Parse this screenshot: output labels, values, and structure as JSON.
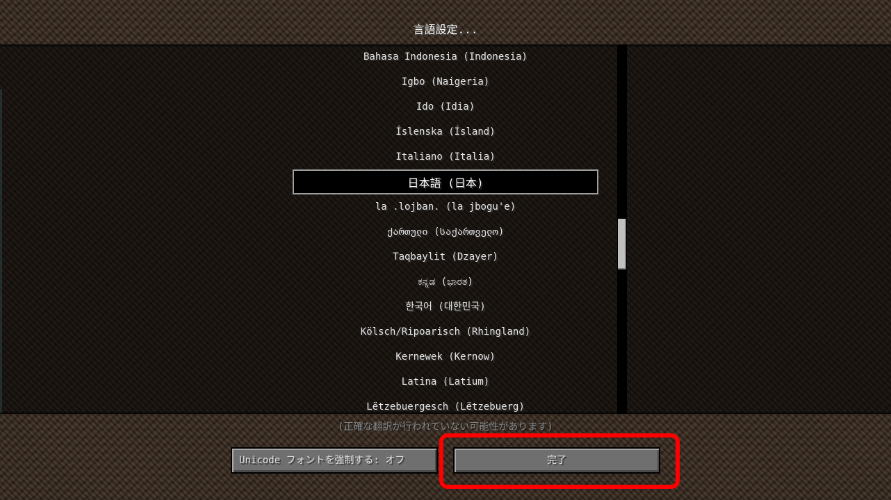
{
  "header": {
    "title": "言語設定..."
  },
  "languages": [
    {
      "label": "Bahasa Indonesia (Indonesia)",
      "selected": false
    },
    {
      "label": "Igbo (Naigeria)",
      "selected": false
    },
    {
      "label": "Ido (Idia)",
      "selected": false
    },
    {
      "label": "Íslenska (Ísland)",
      "selected": false
    },
    {
      "label": "Italiano (Italia)",
      "selected": false
    },
    {
      "label": "日本語 (日本)",
      "selected": true
    },
    {
      "label": "la .lojban. (la jbogu'e)",
      "selected": false
    },
    {
      "label": "ქართული (საქართველო)",
      "selected": false
    },
    {
      "label": "Taqbaylit (Dzayer)",
      "selected": false
    },
    {
      "label": "ಕನ್ನಡ (ಭಾರತ)",
      "selected": false
    },
    {
      "label": "한국어 (대한민국)",
      "selected": false
    },
    {
      "label": "Kölsch/Ripoarisch (Rhingland)",
      "selected": false
    },
    {
      "label": "Kernewek (Kernow)",
      "selected": false
    },
    {
      "label": "Latina (Latium)",
      "selected": false
    },
    {
      "label": "Lëtzebuergesch (Lëtzebuerg)",
      "selected": false
    }
  ],
  "footer": {
    "warning": "(正確な翻訳が行われていない可能性があります)",
    "unicode_button": "Unicode フォントを強制する: オフ",
    "done_button": "完了"
  },
  "colors": {
    "highlight": "#ff0000",
    "selected_border": "#a0a0a0"
  }
}
